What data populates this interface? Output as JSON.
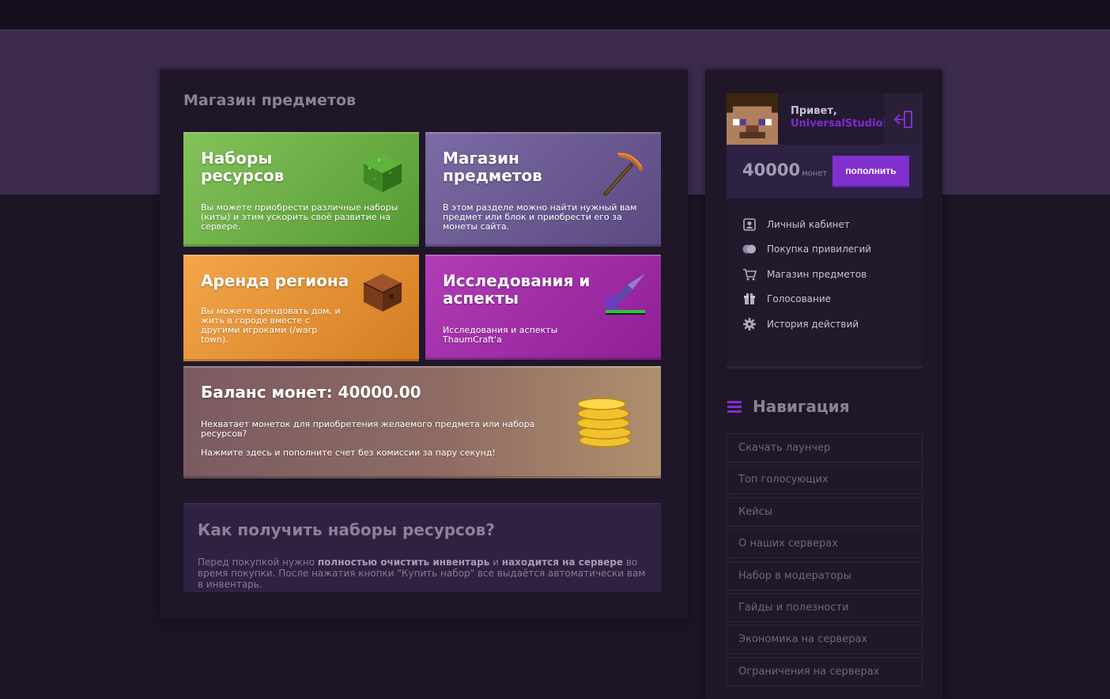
{
  "main": {
    "title": "Магазин предметов",
    "tiles": [
      {
        "title": "Наборы ресурсов",
        "desc": "Вы можете приобрести различные наборы (киты) и этим ускорить своё развитие на сервере.",
        "icon": "grass-block-icon"
      },
      {
        "title": "Магазин предметов",
        "desc": "В этом разделе можно найти нужный вам предмет или блок и приобрести его за монеты сайта.",
        "icon": "pickaxe-icon"
      },
      {
        "title": "Аренда региона",
        "desc": "Вы можете арендовать дом, и жить в городе вместе с другими игроками (/warp town).",
        "icon": "crate-icon"
      },
      {
        "title": "Исследования и аспекты",
        "desc": "Исследования и аспекты ThaumCraft'a",
        "icon": "thaumcraft-tool-icon"
      }
    ],
    "balance": {
      "title": "Баланс монет: 40000.00",
      "line1": "Нехватает монеток для приобретения желаемого предмета или набора ресурсов?",
      "line2": "Нажмите здесь и пополните счет без комиссии за пару секунд!",
      "icon": "gold-coins-icon"
    },
    "info": {
      "title": "Как получить наборы ресурсов?",
      "t1": "Перед покупкой нужно ",
      "b1": "полностью очистить инвентарь",
      "t2": " и ",
      "b2": "находится на сервере",
      "t3": " во время покупки. После нажатия кнопки \"Купить набор\" все выдаётся автоматически вам в инвентарь."
    }
  },
  "user": {
    "greeting": "Привет,",
    "username": "UniversalStudio!",
    "coins": "40000",
    "coins_unit": "монет",
    "topup_label": "пополнить",
    "menu": [
      {
        "label": "Личный кабинет",
        "icon": "profile-icon"
      },
      {
        "label": "Покупка привилегий",
        "icon": "coins-icon"
      },
      {
        "label": "Магазин предметов",
        "icon": "cart-icon"
      },
      {
        "label": "Голосование",
        "icon": "gift-icon"
      },
      {
        "label": "История действий",
        "icon": "gear-icon"
      }
    ]
  },
  "nav": {
    "title": "Навигация",
    "items": [
      "Скачать лаунчер",
      "Топ голосующих",
      "Кейсы",
      "О наших серверах",
      "Набор в модераторы",
      "Гайды и полезности",
      "Экономика на серверах",
      "Ограничения на серверах"
    ]
  },
  "colors": {
    "accent": "#7f30cf",
    "band": "#3d2b4f",
    "background": "#1b1424"
  }
}
